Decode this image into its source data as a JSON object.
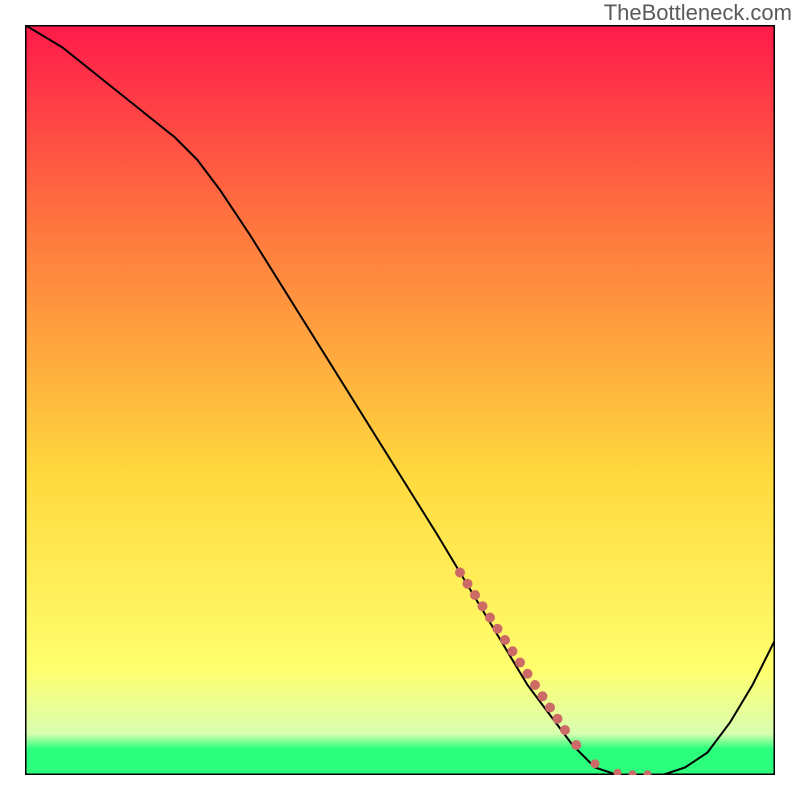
{
  "watermark": "TheBottleneck.com",
  "colors": {
    "gradient_top": "#ff1a4b",
    "gradient_upper": "#ff7a3e",
    "gradient_mid": "#ffd93e",
    "gradient_lower": "#ffff6e",
    "gradient_bottom_band_light": "#d9ffb0",
    "gradient_bottom_band": "#2bff7c",
    "plot_border": "#000000",
    "curve": "#000000",
    "marker": "#cc6a66"
  },
  "chart_data": {
    "type": "line",
    "title": "",
    "xlabel": "",
    "ylabel": "",
    "xlim": [
      0,
      100
    ],
    "ylim": [
      0,
      100
    ],
    "series": [
      {
        "name": "bottleneck-curve",
        "x": [
          0,
          5,
          10,
          15,
          20,
          23,
          26,
          30,
          35,
          40,
          45,
          50,
          55,
          58,
          61,
          64,
          67,
          70,
          73,
          76,
          79,
          82,
          85,
          88,
          91,
          94,
          97,
          100
        ],
        "y": [
          100,
          97,
          93,
          89,
          85,
          82,
          78,
          72,
          64,
          56,
          48,
          40,
          32,
          27,
          22,
          17,
          12,
          8,
          4,
          1,
          0,
          0,
          0,
          1,
          3,
          7,
          12,
          18
        ]
      }
    ],
    "markers": {
      "name": "highlight-dots",
      "x": [
        58,
        59,
        60,
        61,
        62,
        63,
        64,
        65,
        66,
        67,
        68,
        69,
        70,
        71,
        72,
        73.5,
        76,
        79,
        81,
        83
      ],
      "y": [
        27,
        25.5,
        24,
        22.5,
        21,
        19.5,
        18,
        16.5,
        15,
        13.5,
        12,
        10.5,
        9,
        7.5,
        6,
        4,
        1.5,
        0.3,
        0.1,
        0.1
      ],
      "r": [
        5,
        5,
        5,
        5,
        5,
        5,
        5,
        5,
        5,
        5,
        5,
        5,
        5,
        5,
        5,
        5,
        4.5,
        4,
        4,
        4
      ]
    },
    "legend": null,
    "grid": false
  }
}
